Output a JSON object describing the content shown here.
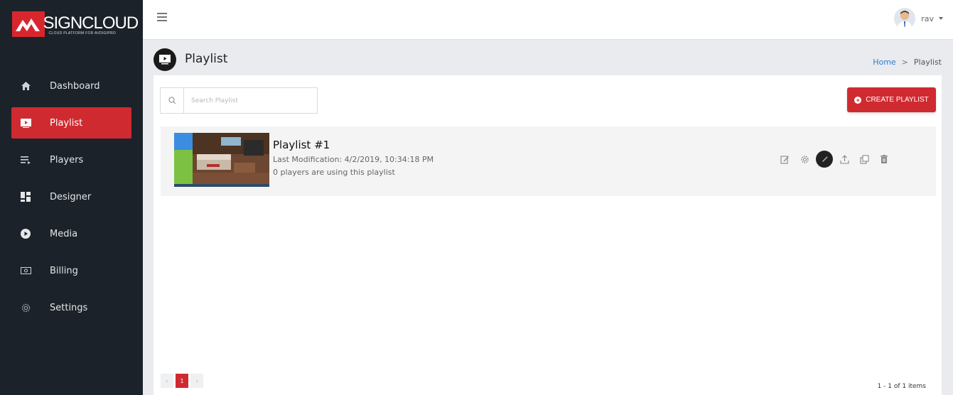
{
  "brand": {
    "name": "SIGNCLOUD",
    "tagline": "CLOUD PLATFORM FOR AVDIGIPRO",
    "accent": "#d02a31"
  },
  "sidebar": {
    "items": [
      {
        "label": "Dashboard",
        "icon": "home-icon",
        "active": false
      },
      {
        "label": "Playlist",
        "icon": "playlist-icon",
        "active": true
      },
      {
        "label": "Players",
        "icon": "players-icon",
        "active": false
      },
      {
        "label": "Designer",
        "icon": "designer-icon",
        "active": false
      },
      {
        "label": "Media",
        "icon": "media-icon",
        "active": false
      },
      {
        "label": "Billing",
        "icon": "billing-icon",
        "active": false
      },
      {
        "label": "Settings",
        "icon": "gear-icon",
        "active": false
      }
    ]
  },
  "topbar": {
    "username": "rav"
  },
  "page": {
    "title": "Playlist"
  },
  "breadcrumb": {
    "home": "Home",
    "separator": ">",
    "current": "Playlist"
  },
  "search": {
    "placeholder": "Search Playlist"
  },
  "create_button": {
    "label": "CREATE PLAYLIST"
  },
  "playlists": [
    {
      "title": "Playlist #1",
      "modified": "Last Modification: 4/2/2019, 10:34:18 PM",
      "usage": "0 players are using this playlist"
    }
  ],
  "pagination": {
    "prev": "‹",
    "page": "1",
    "next": "›",
    "summary": "1 - 1 of 1 items"
  }
}
